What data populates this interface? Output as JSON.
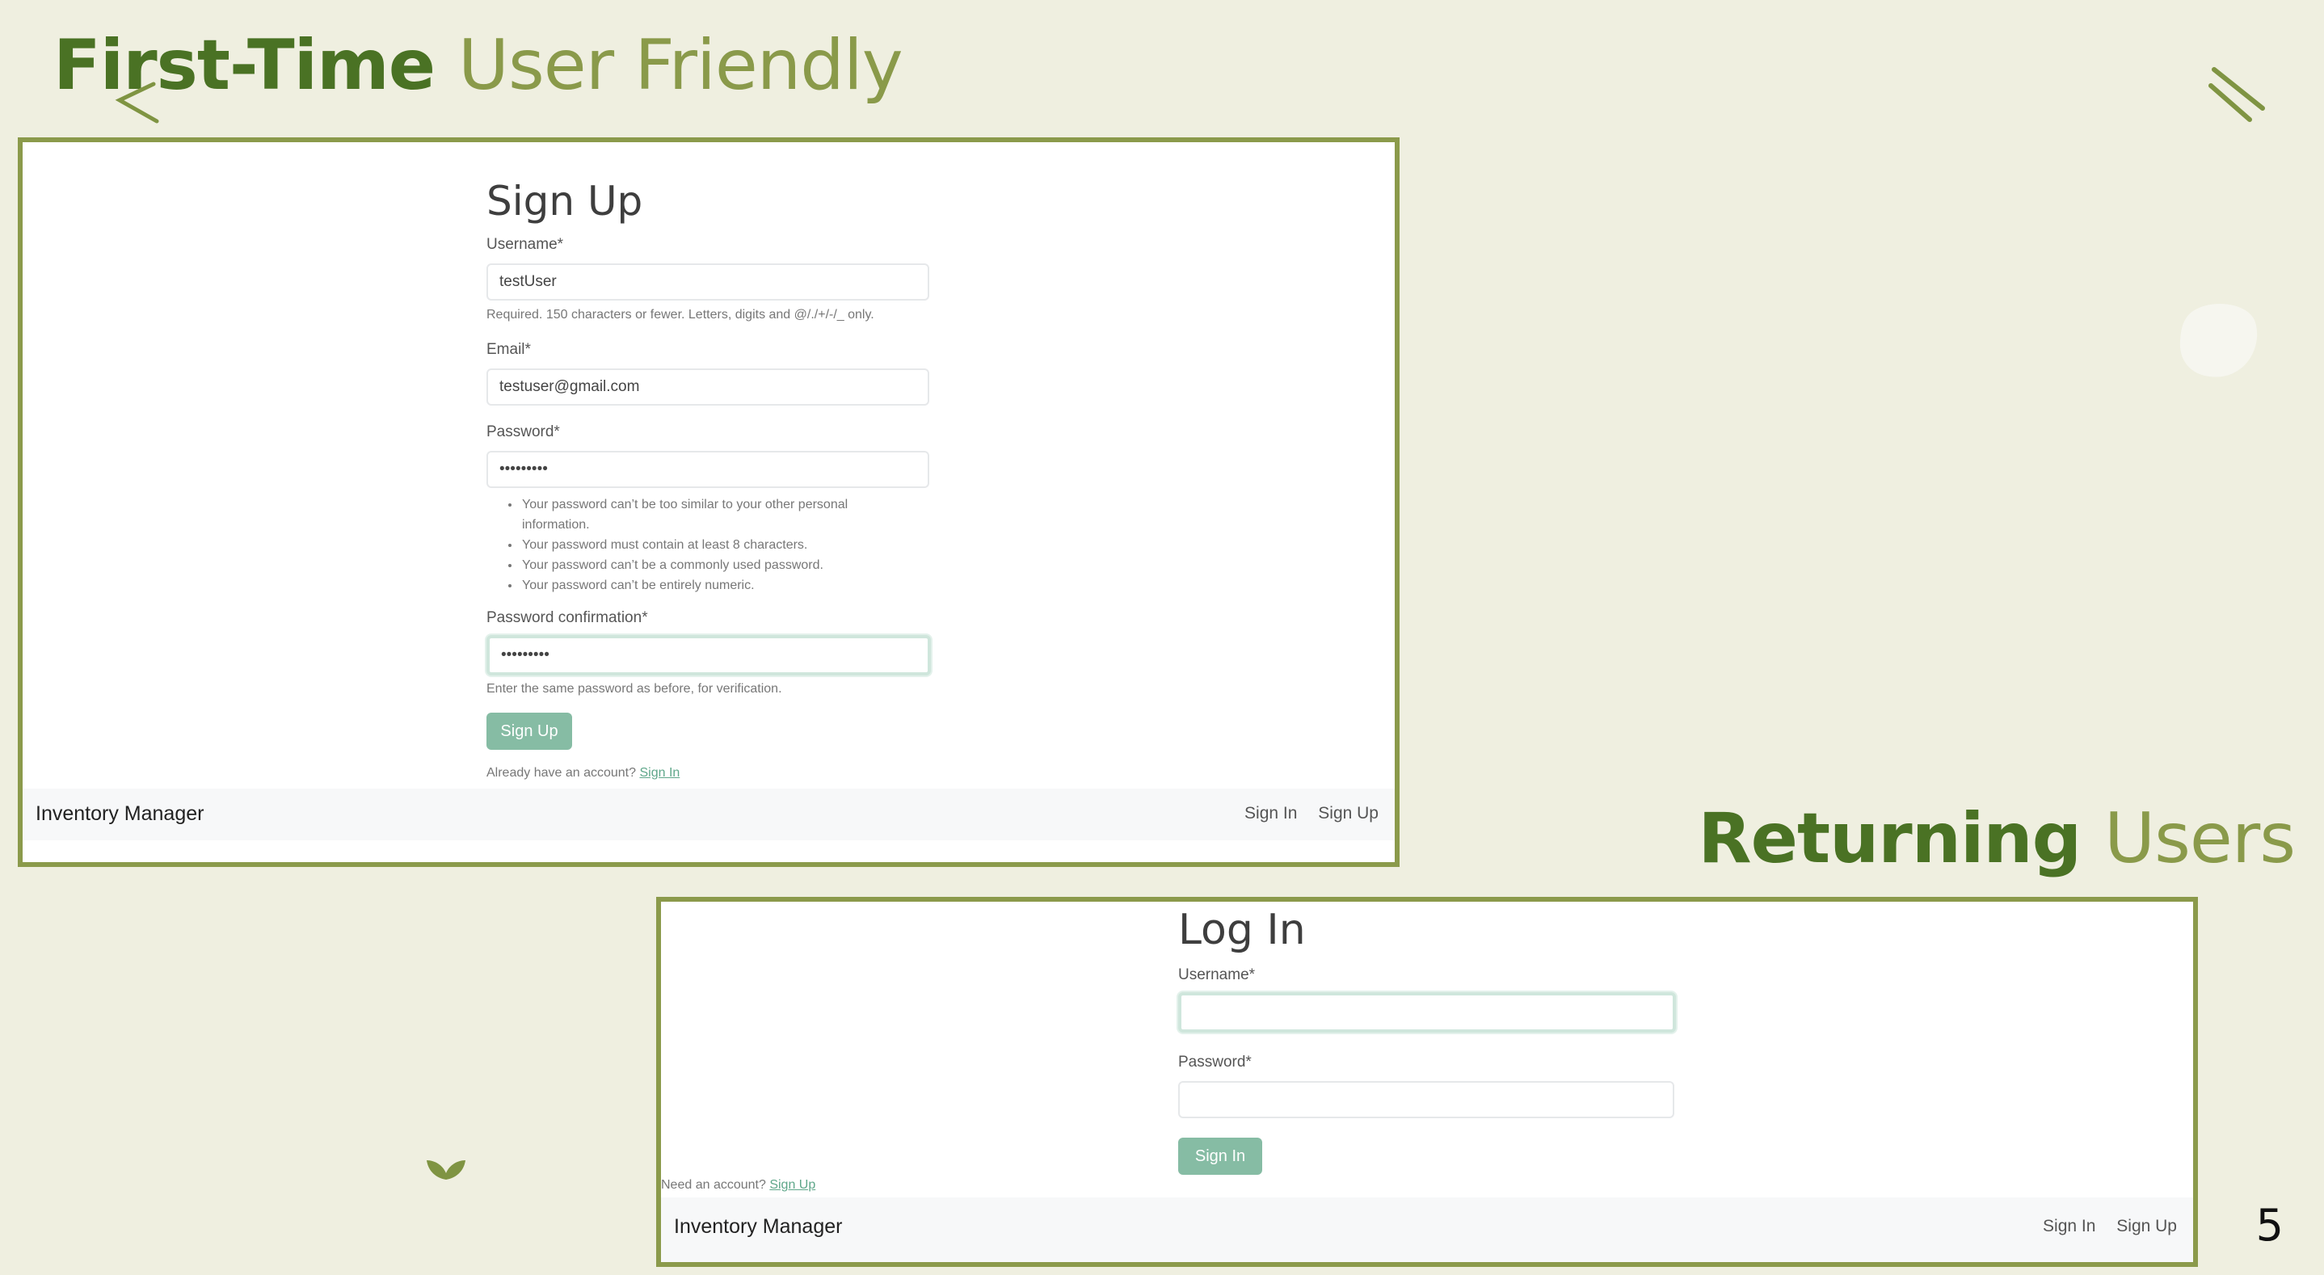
{
  "slide": {
    "title_strong": "First-Time",
    "title_light": "User Friendly",
    "returning_strong": "Returning",
    "returning_light": "Users",
    "page_number": "5"
  },
  "signup": {
    "title": "Sign Up",
    "username_label": "Username*",
    "username_value": "testUser",
    "username_help": "Required. 150 characters or fewer. Letters, digits and @/./+/-/_ only.",
    "email_label": "Email*",
    "email_value": "testuser@gmail.com",
    "password_label": "Password*",
    "password_value": "•••••••••",
    "password_rules": [
      "Your password can’t be too similar to your other personal information.",
      "Your password must contain at least 8 characters.",
      "Your password can’t be a commonly used password.",
      "Your password can’t be entirely numeric."
    ],
    "confirm_label": "Password confirmation*",
    "confirm_value": "•••••••••",
    "confirm_help": "Enter the same password as before, for verification.",
    "submit_label": "Sign Up",
    "account_text": "Already have an account?",
    "account_link": "Sign In",
    "navbar": {
      "brand": "Inventory Manager",
      "link_signin": "Sign In",
      "link_signup": "Sign Up"
    }
  },
  "login": {
    "title": "Log In",
    "username_label": "Username*",
    "username_value": "",
    "password_label": "Password*",
    "password_value": "",
    "submit_label": "Sign In",
    "account_text": "Need an account?",
    "account_link": "Sign Up",
    "navbar": {
      "brand": "Inventory Manager",
      "link_signin": "Sign In",
      "link_signup": "Sign Up"
    }
  },
  "colors": {
    "background": "#efefe0",
    "title_dark_green": "#4a7224",
    "title_light_green": "#8a9a4a",
    "frame_border": "#8b9a4b",
    "button": "#86bca4",
    "link": "#5fa78a"
  }
}
